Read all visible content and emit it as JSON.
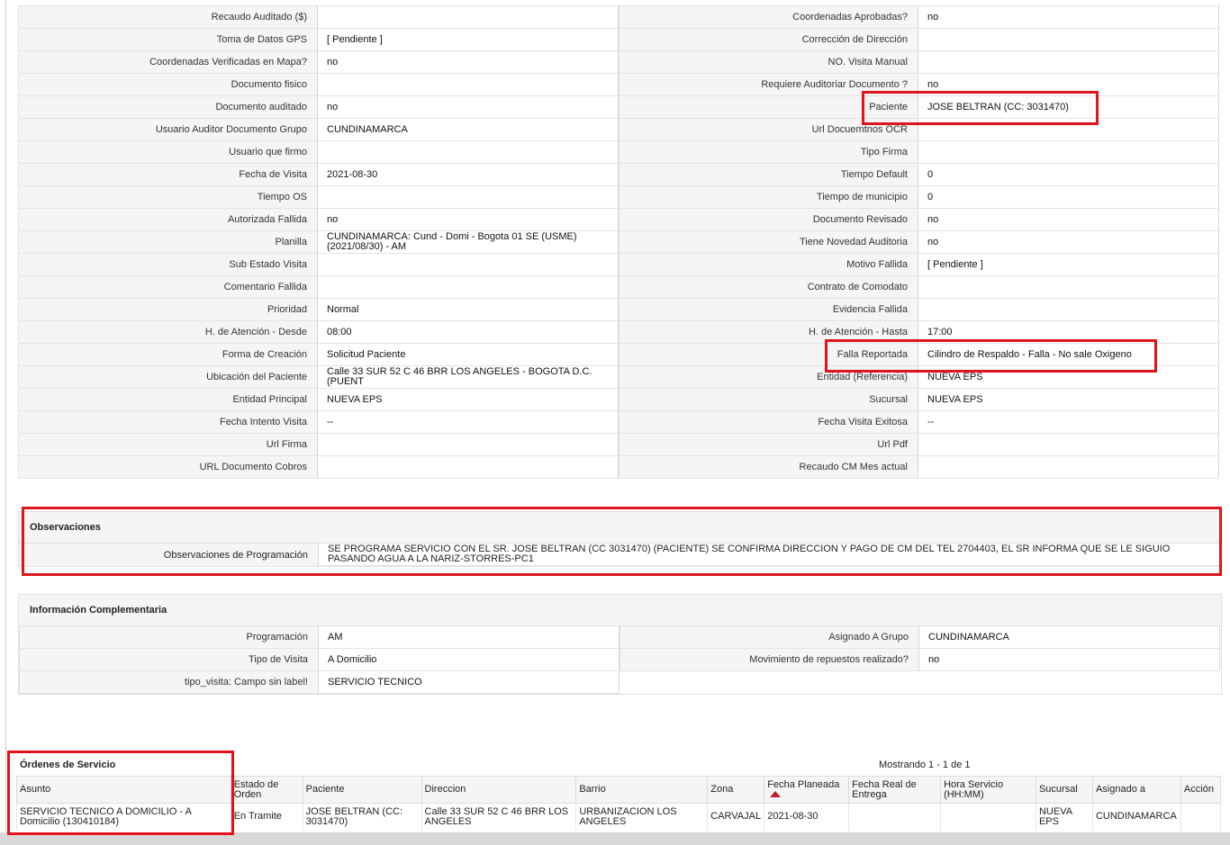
{
  "detail": [
    {
      "l1": "Recaudo Auditado ($)",
      "v1": "",
      "l2": "Coordenadas Aprobadas?",
      "v2": "no"
    },
    {
      "l1": "Toma de Datos GPS",
      "v1": "[ Pendiente ]",
      "l2": "Corrección de Dirección",
      "v2": ""
    },
    {
      "l1": "Coordenadas Verificadas en Mapa?",
      "v1": "no",
      "l2": "NO. Visita Manual",
      "v2": ""
    },
    {
      "l1": "Documento fisico",
      "v1": "",
      "l2": "Requiere Auditoriar Documento ?",
      "v2": "no"
    },
    {
      "l1": "Documento auditado",
      "v1": "no",
      "l2": "Paciente",
      "v2": "JOSE BELTRAN (CC: 3031470)"
    },
    {
      "l1": "Usuario Auditor Documento Grupo",
      "v1": "CUNDINAMARCA",
      "l2": "Url Docuemtnos OCR",
      "v2": ""
    },
    {
      "l1": "Usuario que firmo",
      "v1": "",
      "l2": "Tipo Firma",
      "v2": ""
    },
    {
      "l1": "Fecha de Visita",
      "v1": "2021-08-30",
      "l2": "Tiempo Default",
      "v2": "0"
    },
    {
      "l1": "Tiempo OS",
      "v1": "",
      "l2": "Tiempo de municipio",
      "v2": "0"
    },
    {
      "l1": "Autorizada Fallida",
      "v1": "no",
      "l2": "Documento Revisado",
      "v2": "no"
    },
    {
      "l1": "Planilla",
      "v1": "CUNDINAMARCA: Cund - Domi - Bogota 01 SE (USME) (2021/08/30) - AM",
      "l2": "Tiene Novedad Auditoria",
      "v2": "no"
    },
    {
      "l1": "Sub Estado Visita",
      "v1": "",
      "l2": "Motivo Fallida",
      "v2": "[ Pendiente ]"
    },
    {
      "l1": "Comentario Fallida",
      "v1": "",
      "l2": "Contrato de Comodato",
      "v2": ""
    },
    {
      "l1": "Prioridad",
      "v1": "Normal",
      "l2": "Evidencia Fallida",
      "v2": ""
    },
    {
      "l1": "H. de Atención - Desde",
      "v1": "08:00",
      "l2": "H. de Atención - Hasta",
      "v2": "17:00"
    },
    {
      "l1": "Forma de Creación",
      "v1": "Solicitud Paciente",
      "l2": "Falla Reportada",
      "v2": "Cilindro de Respaldo - Falla - No sale Oxigeno"
    },
    {
      "l1": "Ubicación del Paciente",
      "v1": "Calle 33 SUR 52 C 46 BRR LOS ANGELES - BOGOTA D.C. (PUENT",
      "l2": "Entidad (Referencia)",
      "v2": "NUEVA EPS"
    },
    {
      "l1": "Entidad Principal",
      "v1": "NUEVA EPS",
      "l2": "Sucursal",
      "v2": "NUEVA EPS"
    },
    {
      "l1": "Fecha Intento Visita",
      "v1": "--",
      "l2": "Fecha Visita Exitosa",
      "v2": "--"
    },
    {
      "l1": "Url Firma",
      "v1": "",
      "l2": "Url Pdf",
      "v2": ""
    },
    {
      "l1": "URL Documento Cobros",
      "v1": "",
      "l2": "Recaudo CM Mes actual",
      "v2": ""
    }
  ],
  "observaciones": {
    "title": "Observaciones",
    "label": "Observaciones de Programación",
    "value": "SE PROGRAMA SERVICIO CON EL SR. JOSE BELTRAN (CC 3031470) (PACIENTE) SE CONFIRMA DIRECCION Y PAGO DE CM DEL TEL 2704403, EL SR INFORMA QUE SE LE SIGUIO PASANDO AGUA A LA NARIZ-STORRES-PC1"
  },
  "complementaria": {
    "title": "Información Complementaria",
    "rows": [
      {
        "l1": "Programación",
        "v1": "AM",
        "l2": "Asignado A Grupo",
        "v2": "CUNDINAMARCA"
      },
      {
        "l1": "Tipo de Visita",
        "v1": "A Domicilio",
        "l2": "Movimiento de repuestos realizado?",
        "v2": "no"
      },
      {
        "l1": "tipo_visita: Campo sin label!",
        "v1": "SERVICIO TECNICO"
      }
    ]
  },
  "orders": {
    "title": "Órdenes de Servicio",
    "showing": "Mostrando 1 - 1 de 1",
    "headers": [
      "Asunto",
      "Estado de Orden",
      "Paciente",
      "Direccion",
      "Barrio",
      "Zona",
      "Fecha Planeada",
      "Fecha Real de Entrega",
      "Hora Servicio (HH:MM)",
      "Sucursal",
      "Asignado a",
      "Acción"
    ],
    "rows": [
      [
        "SERVICIO TECNICO A DOMICILIO - A Domicilio (130410184)",
        "En Tramite",
        "JOSE BELTRAN (CC: 3031470)",
        "Calle 33 SUR 52 C 46 BRR LOS ANGELES",
        "URBANIZACION LOS ANGELES",
        "CARVAJAL",
        "2021-08-30",
        "",
        "",
        "NUEVA EPS",
        "CUNDINAMARCA",
        ""
      ]
    ]
  },
  "colors": {
    "highlight": "#e0141c",
    "sort_icon": "#c0202a"
  }
}
